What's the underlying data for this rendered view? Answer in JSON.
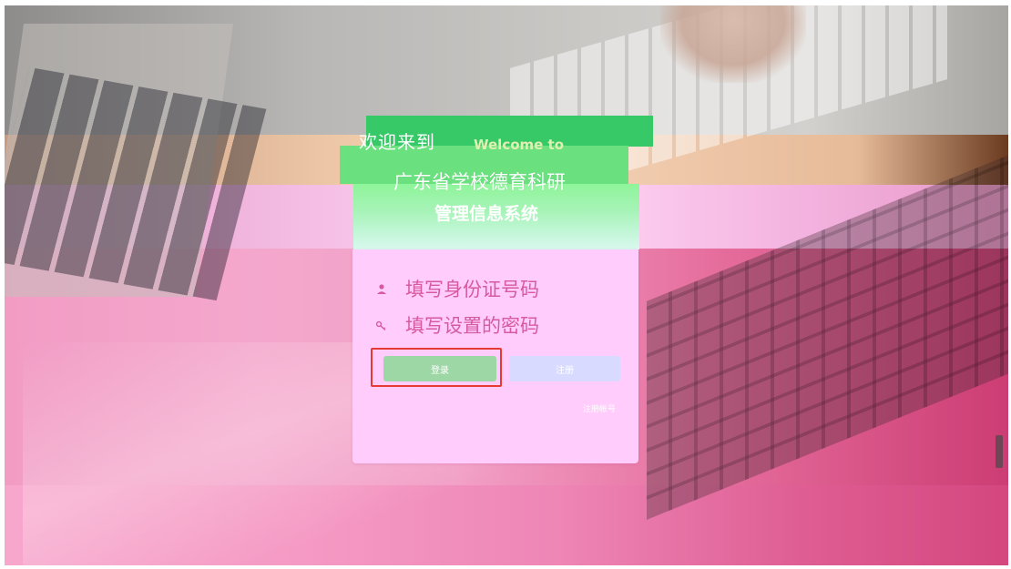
{
  "header": {
    "welcome_cn": "欢迎来到",
    "welcome_en": "Welcome to",
    "system_title_line1": "广东省学校德育科研",
    "system_title_line2": "管理信息系统"
  },
  "login_form": {
    "id_placeholder": "填写身份证号码",
    "password_placeholder": "填写设置的密码",
    "login_label": "登录",
    "reset_label": "注册",
    "register_link": "注册帐号"
  },
  "icons": {
    "user": "user-icon",
    "key": "key-icon"
  },
  "colors": {
    "banner_green": "#37c868",
    "banner_light_green": "#8ef59a",
    "card_pink": "#ffccfb",
    "login_button": "#9ed7a6",
    "reset_button": "#d8dbff",
    "focus_outline": "#e53935",
    "placeholder_text": "#d65aa0"
  }
}
